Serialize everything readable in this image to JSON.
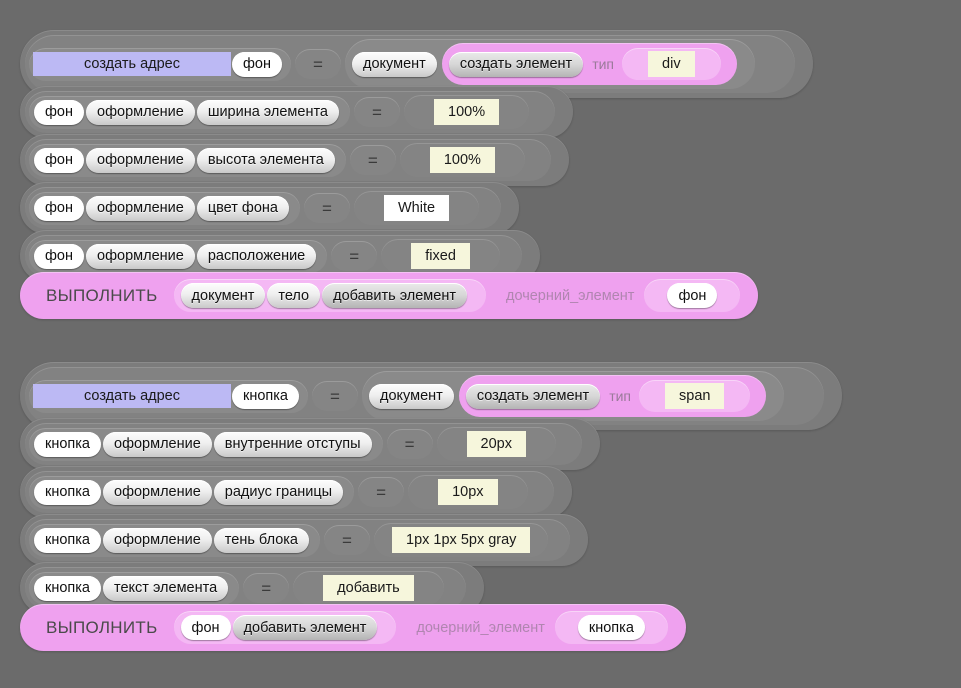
{
  "theme": {
    "background": "#6b6b6b",
    "slot_gray": "#7c7c7c",
    "pill_light": "#efefef",
    "accent_pink": "#efa1ef",
    "accent_pink_light": "#f4b8f4",
    "field_cream": "#f6f6dc",
    "field_lavender": "#bcb9f4",
    "field_white": "#ffffff"
  },
  "labels": {
    "equals": "=",
    "type_param": "тип",
    "child_param": "дочерний_элемент",
    "execute": "ВЫПОЛНИТЬ"
  },
  "blocks": [
    {
      "id": "create-background",
      "kind": "assignment-create",
      "assign_action": "создать адрес",
      "target": "фон",
      "operator": "=",
      "source_object": "документ",
      "create_method": "создать элемент",
      "param_label": "тип",
      "param_value": "div"
    },
    {
      "id": "background-width",
      "kind": "assignment",
      "path": [
        "фон",
        "оформление",
        "ширина элемента"
      ],
      "operator": "=",
      "value": "100%",
      "value_style": "cream"
    },
    {
      "id": "background-height",
      "kind": "assignment",
      "path": [
        "фон",
        "оформление",
        "высота элемента"
      ],
      "operator": "=",
      "value": "100%",
      "value_style": "cream"
    },
    {
      "id": "background-color",
      "kind": "assignment",
      "path": [
        "фон",
        "оформление",
        "цвет фона"
      ],
      "operator": "=",
      "value": "White",
      "value_style": "white"
    },
    {
      "id": "background-position",
      "kind": "assignment",
      "path": [
        "фон",
        "оформление",
        "расположение"
      ],
      "operator": "=",
      "value": "fixed",
      "value_style": "cream"
    },
    {
      "id": "execute-append-background",
      "kind": "execute",
      "title": "ВЫПОЛНИТЬ",
      "call_path": [
        "документ",
        "тело",
        "добавить элемент"
      ],
      "param_label": "дочерний_элемент",
      "param_value": "фон"
    },
    {
      "id": "create-button",
      "kind": "assignment-create",
      "assign_action": "создать адрес",
      "target": "кнопка",
      "operator": "=",
      "source_object": "документ",
      "create_method": "создать элемент",
      "param_label": "тип",
      "param_value": "span"
    },
    {
      "id": "button-padding",
      "kind": "assignment",
      "path": [
        "кнопка",
        "оформление",
        "внутренние отступы"
      ],
      "operator": "=",
      "value": "20px",
      "value_style": "cream"
    },
    {
      "id": "button-border-radius",
      "kind": "assignment",
      "path": [
        "кнопка",
        "оформление",
        "радиус границы"
      ],
      "operator": "=",
      "value": "10px",
      "value_style": "cream"
    },
    {
      "id": "button-box-shadow",
      "kind": "assignment",
      "path": [
        "кнопка",
        "оформление",
        "тень блока"
      ],
      "operator": "=",
      "value": "1px 1px 5px gray",
      "value_style": "cream"
    },
    {
      "id": "button-text",
      "kind": "assignment",
      "path": [
        "кнопка",
        "текст элемента"
      ],
      "operator": "=",
      "value": "добавить",
      "value_style": "cream"
    },
    {
      "id": "execute-append-button",
      "kind": "execute",
      "title": "ВЫПОЛНИТЬ",
      "call_path": [
        "фон",
        "добавить элемент"
      ],
      "param_label": "дочерний_элемент",
      "param_value": "кнопка"
    }
  ]
}
